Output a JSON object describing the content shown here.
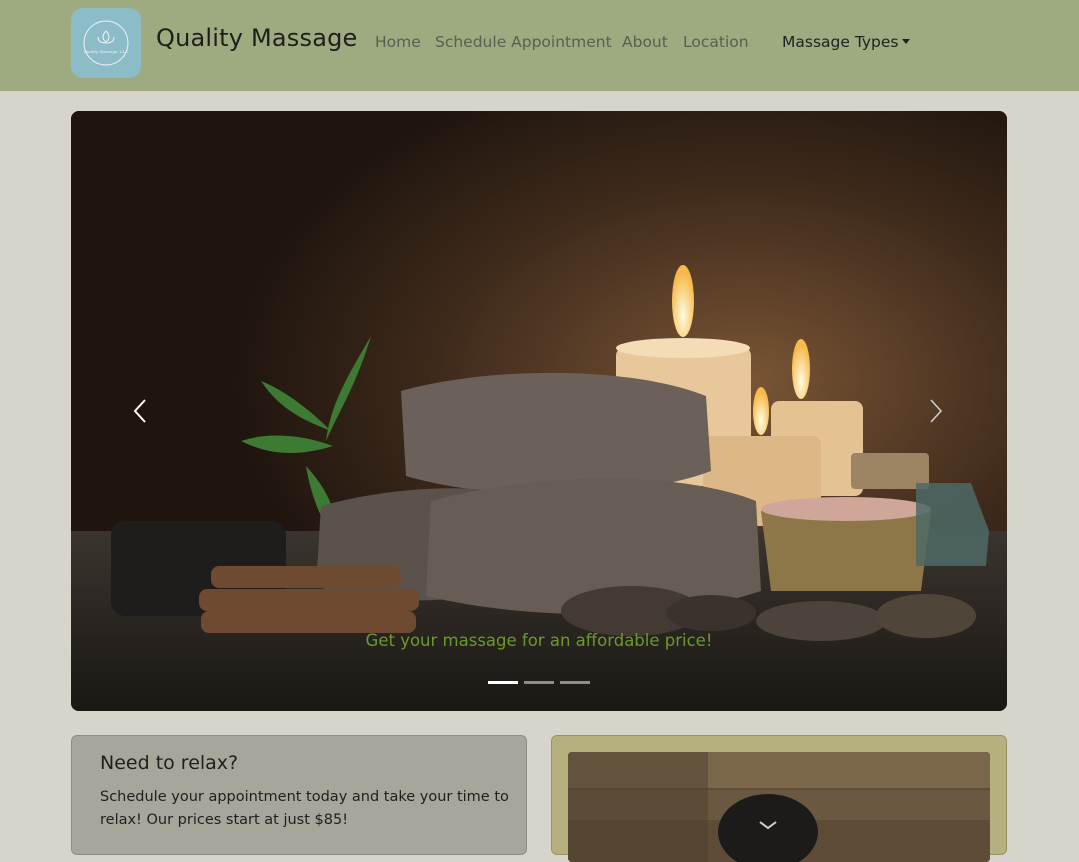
{
  "brand": {
    "name": "Quality Massage",
    "logo_text": "Quality Massage, LLC"
  },
  "nav": {
    "links": [
      "Home",
      "Schedule Appointment",
      "About",
      "Location"
    ],
    "dropdown_label": "Massage Types"
  },
  "carousel": {
    "caption": "Get your massage for an affordable price!",
    "slide_count": 3,
    "active_index": 0,
    "prev_icon": "chevron-left-icon",
    "next_icon": "chevron-right-icon"
  },
  "info_card": {
    "title": "Need to relax?",
    "text": "Schedule your appointment today and take your time to relax! Our prices start at just $85!"
  },
  "colors": {
    "navbar": "#9eaa80",
    "page_background": "#d7d5cb",
    "caption": "#6a9a2e",
    "card_left": "#a8a69a",
    "card_right": "#b5b07e"
  }
}
